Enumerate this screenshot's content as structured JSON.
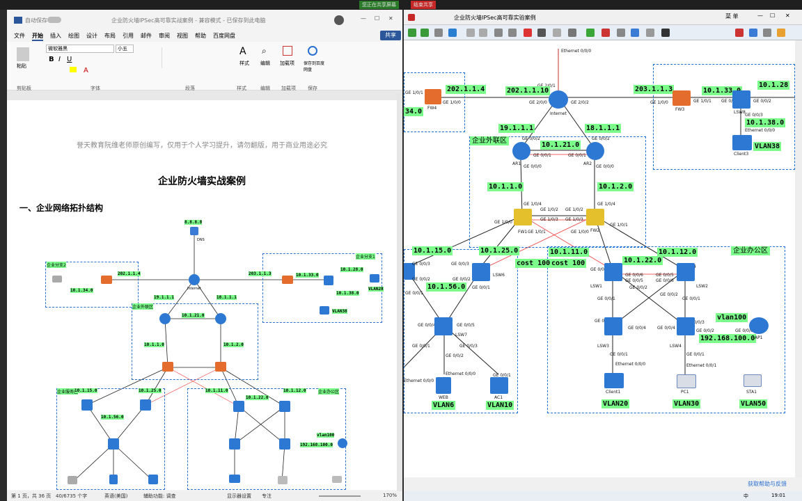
{
  "sharebar": {
    "sharing": "您正在共享屏幕",
    "stop": "结束共享"
  },
  "word": {
    "title_file": "企业防火墙IPSec高可靠实战案例 - 兼容模式 - 已保存到此电脑",
    "autosave": "自动保存",
    "share_btn": "共享",
    "menu": [
      "文件",
      "开始",
      "插入",
      "绘图",
      "设计",
      "布局",
      "引用",
      "邮件",
      "审阅",
      "视图",
      "帮助",
      "百度网盘"
    ],
    "font_name": "微软雅黑",
    "font_size": "小五",
    "groups": [
      "剪贴板",
      "字体",
      "段落",
      "样式",
      "编辑",
      "加载项",
      "保存"
    ],
    "ribbon_btns": {
      "paste": "粘贴",
      "style": "样式",
      "edit": "编辑",
      "addin": "加载项",
      "save": "保存到百度网盘"
    },
    "watermark": "誉天教育阮维老师原创编写，仅用于个人学习提升，请勿翻版，用于商业用途必究",
    "doc_title": "企业防火墙实战案例",
    "section1": "一、企业网络拓扑结构",
    "status": {
      "page": "第 1 页，共 36 页",
      "words": "40/6735 个字",
      "lang": "英语(美国)",
      "access": "辅助功能: 调查",
      "display": "显示器设置",
      "focus": "专注",
      "zoom": "170%"
    }
  },
  "diagram_small": {
    "dns": "8.8.8.8",
    "dns_name": "DNS",
    "isp": "Internet",
    "fw4_ip": "202.1.1.4",
    "pc3": "10.1.34.0",
    "fw3_ip": "203.1.1.3",
    "lsw8_net": "10.1.33.0",
    "c2_net": "10.1.28.0",
    "c3_net": "10.1.38.0",
    "vlan38": "VLAN38",
    "vlan28": "VLAN28",
    "ar1": "19.1.1.1",
    "ar2": "18.1.1.1",
    "net21": "10.1.21.0",
    "net1": "10.1.1.0",
    "net2": "10.1.2.0",
    "z2": "企业分支2",
    "z1": "企业分支1",
    "zext": "企业外联区",
    "zsrv": "企业服务区",
    "zoff": "企业办公区",
    "n15": "10.1.15.0",
    "n25": "10.1.25.0",
    "n56": "10.1.56.0",
    "n11": "10.1.11.0",
    "n12": "10.1.12.0",
    "n22": "10.1.22.0",
    "vlan100": "vlan100",
    "ap_net": "192.168.100.0"
  },
  "ensp": {
    "title": "企业防火墙IPSec高可靠实验案例",
    "menu": "菜 单",
    "status_right": "获取帮助与反馈",
    "labels": {
      "internet": "Internet",
      "eth000": "Ethernet 0/0/0",
      "ge201": "GE 2/0/1",
      "ge200": "GE 2/0/0",
      "ge202": "GE 2/0/2",
      "fw4_ip": "202.1.1.4",
      "isp_ip": "202.1.1.10",
      "fw3_ip": "203.1.1.3",
      "n33": "10.1.33.0",
      "n28": "10.1.28",
      "n38": "10.1.38.0",
      "n34": "34.0",
      "fw4": "FW4",
      "fw3": "FW3",
      "lsw8": "LSW8",
      "client3": "Client3",
      "vlan38": "VLAN38",
      "ar1_ip": "19.1.1.1",
      "ar2_ip": "18.1.1.1",
      "ar1": "AR1",
      "ar2": "AR2",
      "n21": "10.1.21.0",
      "n1": "10.1.1.0",
      "n2": "10.1.2.0",
      "fw1": "FW1",
      "fw2": "FW2",
      "zext": "企业外联区",
      "zoff": "企业办公区",
      "n15": "10.1.15.0",
      "n25": "10.1.25.0",
      "cost1": "cost 100",
      "cost2": "cost 100",
      "n11": "10.1.11.0",
      "n12": "10.1.12.0",
      "n22": "10.1.22.0",
      "n56": "10.1.56.0",
      "lsw6": "LSW6",
      "lsw7": "LSW7",
      "lsw1": "LSW1",
      "lsw2": "LSW2",
      "lsw3": "LSW3",
      "lsw4": "LSW4",
      "web": "WEB",
      "ac1": "AC1",
      "client1": "Client1",
      "pc1": "PC1",
      "sta1": "STA1",
      "ap1": "AP1",
      "vlan6": "VLAN6",
      "vlan10": "VLAN10",
      "vlan20": "VLAN20",
      "vlan30": "VLAN30",
      "vlan50": "VLAN50",
      "vlan100": "vlan100",
      "ap_net": "192.168.100.0",
      "ge100": "GE 1/0/0",
      "ge101": "GE 1/0/1",
      "ge002": "GE 0/0/2",
      "ge001": "GE 0/0/1",
      "ge000": "GE 0/0/0",
      "ge104": "GE 1/0/4",
      "ge102": "GE 1/0/2",
      "ge103": "GE 1/0/3",
      "ge003": "GE 0/0/3",
      "ge004": "GE 0/0/4",
      "ge005": "GE 0/0/5",
      "ge006": "GE 0/0/6",
      "eth001": "Ethernet 0/0/1"
    }
  },
  "taskbar": {
    "time": "19:01",
    "ime": "中"
  }
}
